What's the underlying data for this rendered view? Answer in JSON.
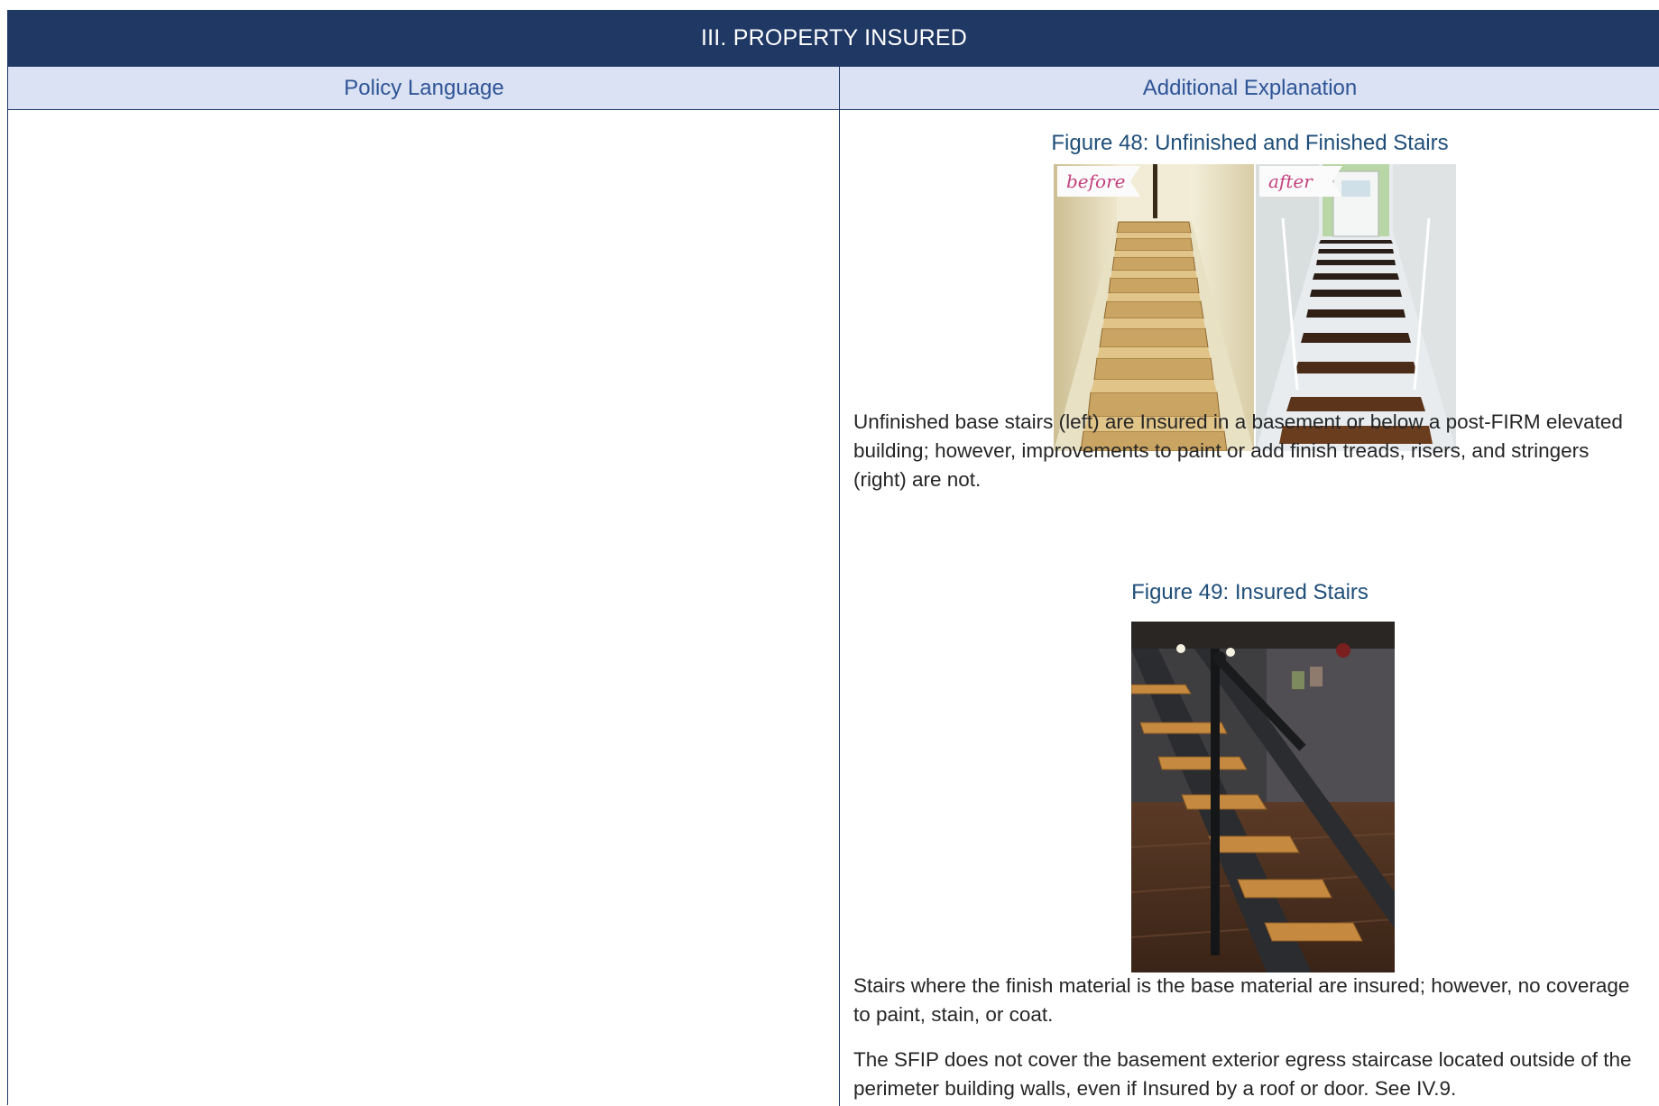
{
  "section": {
    "title": "III. PROPERTY INSURED"
  },
  "columns": {
    "left": "Policy Language",
    "right": "Additional Explanation"
  },
  "figure48": {
    "caption": "Figure 48: Unfinished and Finished Stairs",
    "before_tag": "before",
    "after_tag": "after",
    "description": "Unfinished base stairs (left) are Insured in a basement or below a post-FIRM elevated building; however, improvements to paint or add finish treads, risers, and stringers (right) are not."
  },
  "figure49": {
    "caption": "Figure 49: Insured Stairs",
    "description": "Stairs where the finish material is the base material are insured; however, no coverage to paint, stain, or coat."
  },
  "note": "The SFIP does not cover the basement exterior egress staircase located outside of the perimeter building walls, even if Insured by a roof or door. See IV.9.",
  "colors": {
    "header_bg": "#1f3864",
    "subheader_bg": "#dae2f3",
    "caption": "#1f4e79"
  }
}
